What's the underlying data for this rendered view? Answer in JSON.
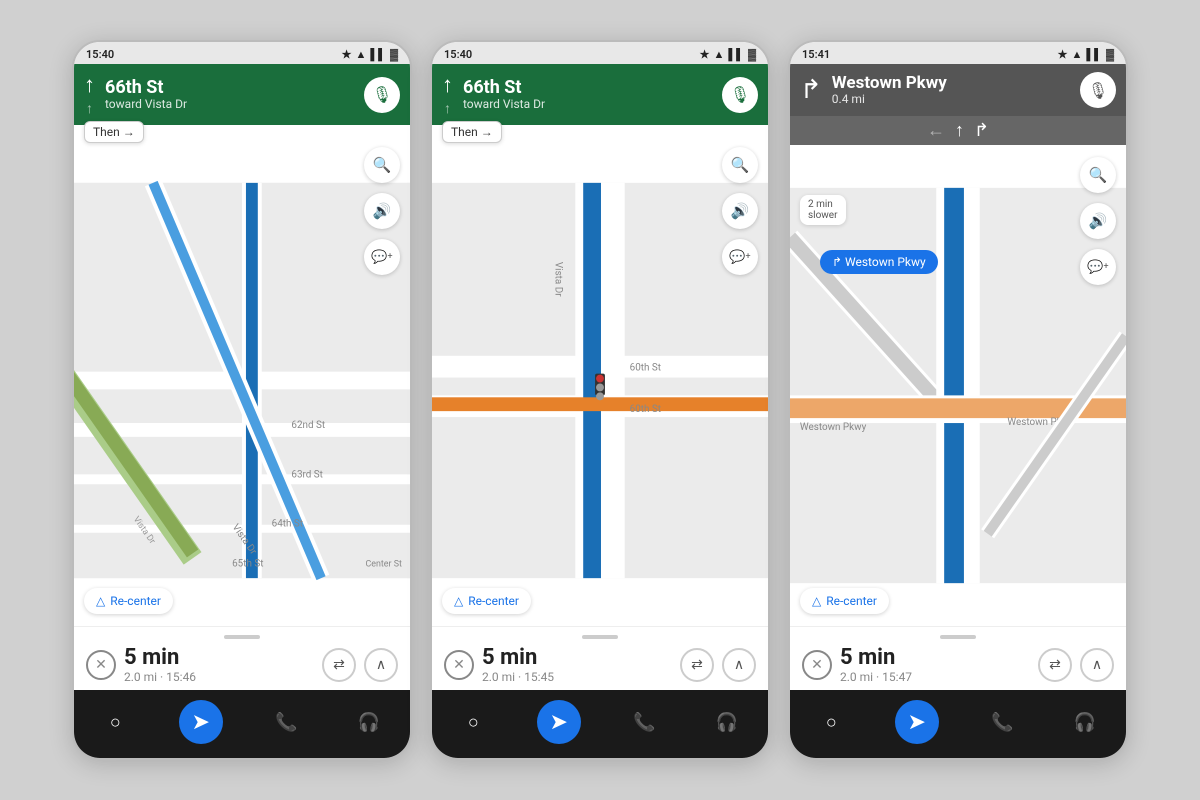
{
  "page": {
    "bg_color": "#d0d0d0"
  },
  "phones": [
    {
      "id": "phone1",
      "status_time": "15:40",
      "nav_bg": "green",
      "nav_arrow": "↑",
      "nav_street_main": "66th St",
      "nav_street_small": "",
      "nav_toward": "toward Vista Dr",
      "then_label": "Then →",
      "show_then": true,
      "show_lanes": false,
      "show_distance": false,
      "trip_time": "5 min",
      "trip_dist": "2.0 mi",
      "trip_eta": "15:46",
      "show_slower": false,
      "show_turn_badge": false
    },
    {
      "id": "phone2",
      "status_time": "15:40",
      "nav_bg": "green",
      "nav_arrow": "↑",
      "nav_street_main": "66th St",
      "nav_street_small": "",
      "nav_toward": "toward Vista Dr",
      "then_label": "Then →",
      "show_then": true,
      "show_lanes": false,
      "show_distance": false,
      "trip_time": "5 min",
      "trip_dist": "2.0 mi",
      "trip_eta": "15:45",
      "show_slower": false,
      "show_turn_badge": false
    },
    {
      "id": "phone3",
      "status_time": "15:41",
      "nav_bg": "gray",
      "nav_arrow": "↱",
      "nav_street_main": "Westown Pkwy",
      "nav_street_small": "",
      "nav_toward": "0.4 mi",
      "then_label": "",
      "show_then": false,
      "show_lanes": true,
      "show_distance": true,
      "trip_time": "5 min",
      "trip_dist": "2.0 mi",
      "trip_eta": "15:47",
      "show_slower": true,
      "slower_text": "2 min\nslower",
      "show_turn_badge": true,
      "turn_badge_text": "↱ Westown Pkwy"
    }
  ],
  "labels": {
    "recenter": "Re-center",
    "then": "Then",
    "search_icon": "🔍",
    "sound_icon": "🔊",
    "report_icon": "💬",
    "mic_icon": "🎙",
    "close_icon": "✕",
    "routes_icon": "⇄",
    "expand_icon": "∧",
    "home_icon": "○",
    "maps_icon": "◆",
    "phone_icon": "📞",
    "headphone_icon": "🎧"
  }
}
